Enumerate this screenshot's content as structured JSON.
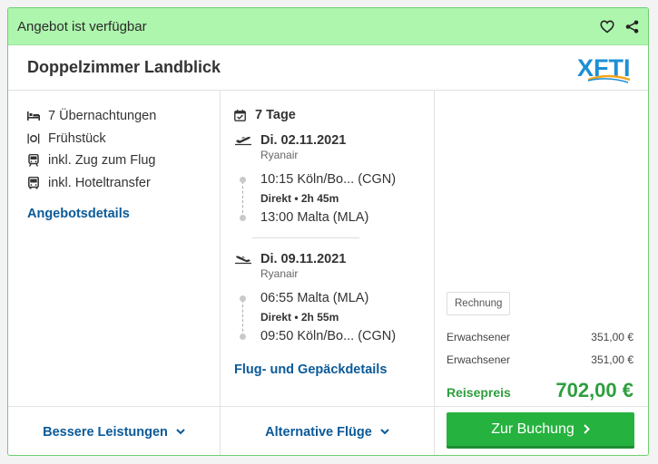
{
  "header": {
    "status": "Angebot ist verfügbar",
    "favorite_icon": "heart-icon",
    "share_icon": "share-icon"
  },
  "offer": {
    "title": "Doppelzimmer Landblick",
    "logo_text": "XFTI",
    "logo_colors": {
      "primary": "#1d8fd6",
      "accent": "#f4a51c"
    }
  },
  "features": [
    {
      "icon": "bed-icon",
      "label": "7 Übernachtungen"
    },
    {
      "icon": "meal-icon",
      "label": "Frühstück"
    },
    {
      "icon": "train-icon",
      "label": "inkl. Zug zum Flug"
    },
    {
      "icon": "bus-icon",
      "label": "inkl. Hoteltransfer"
    }
  ],
  "details_link": "Angebotsdetails",
  "flights": {
    "duration": "7 Tage",
    "outbound": {
      "date": "Di. 02.11.2021",
      "airline": "Ryanair",
      "dep": "10:15 Köln/Bo... (CGN)",
      "info": "Direkt  •  2h 45m",
      "arr": "13:00 Malta (MLA)"
    },
    "inbound": {
      "date": "Di. 09.11.2021",
      "airline": "Ryanair",
      "dep": "06:55 Malta (MLA)",
      "info": "Direkt  •  2h 55m",
      "arr": "09:50 Köln/Bo... (CGN)"
    },
    "details_link": "Flug- und Gepäckdetails"
  },
  "pricing": {
    "badge": "Rechnung",
    "rows": [
      {
        "label": "Erwachsener",
        "value": "351,00 €"
      },
      {
        "label": "Erwachsener",
        "value": "351,00 €"
      }
    ],
    "total_label": "Reisepreis",
    "total_value": "702,00 €"
  },
  "footer": {
    "better_services": "Bessere Leistungen",
    "alt_flights": "Alternative Flüge",
    "book": "Zur Buchung"
  },
  "colors": {
    "status_bg": "#aef5ae",
    "link": "#0a5a99",
    "price_green": "#2e9e3e",
    "button_green": "#26b23f"
  }
}
